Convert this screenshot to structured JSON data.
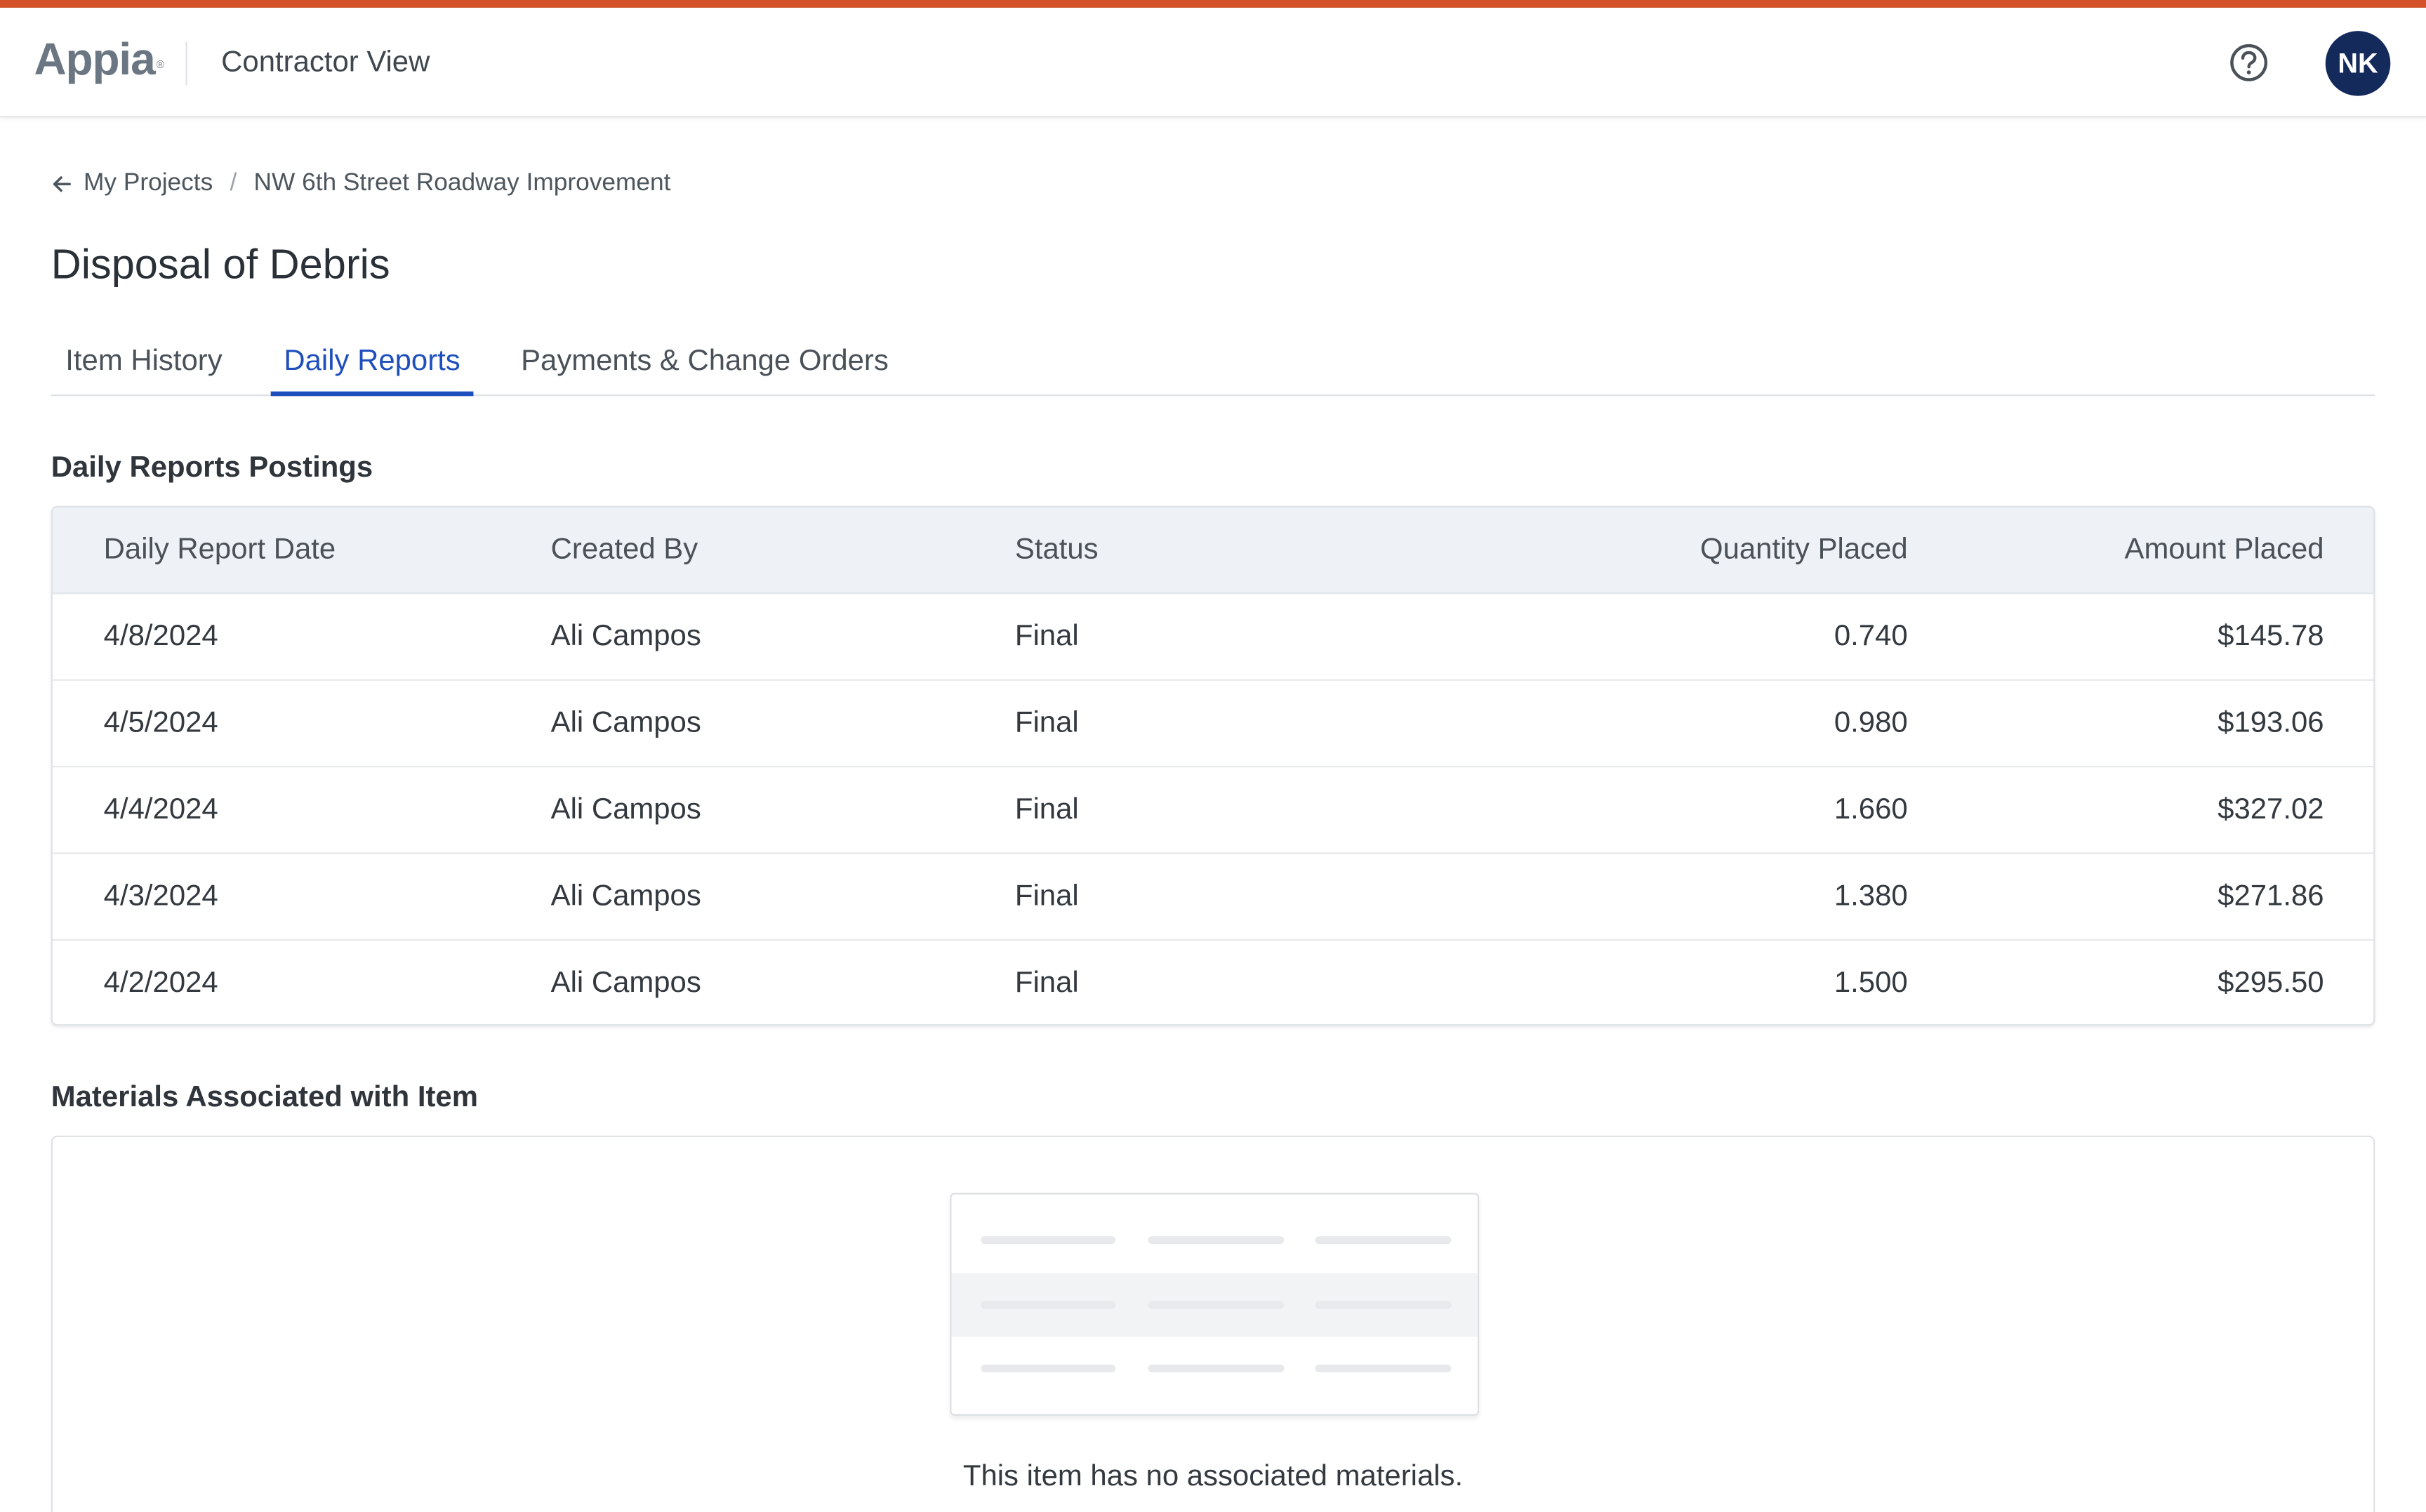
{
  "header": {
    "logo": "Appia",
    "logo_mark": "®",
    "app_title": "Contractor View",
    "help_icon": "question-circle-icon",
    "avatar_initials": "NK",
    "accent_bar_color": "#d4522a",
    "avatar_color": "#142a5b"
  },
  "breadcrumb": {
    "back_icon": "arrow-left-icon",
    "parent": "My Projects",
    "separator": "/",
    "current": "NW 6th Street Roadway Improvement"
  },
  "page": {
    "title": "Disposal of Debris"
  },
  "tabs": [
    {
      "label": "Item History",
      "active": false
    },
    {
      "label": "Daily Reports",
      "active": true
    },
    {
      "label": "Payments & Change Orders",
      "active": false
    }
  ],
  "tab_active_color": "#1f4fbd",
  "daily_reports": {
    "title": "Daily Reports Postings",
    "columns": [
      "Daily Report Date",
      "Created By",
      "Status",
      "Quantity Placed",
      "Amount Placed"
    ],
    "rows": [
      {
        "date": "4/8/2024",
        "created_by": "Ali Campos",
        "status": "Final",
        "quantity": "0.740",
        "amount": "$145.78"
      },
      {
        "date": "4/5/2024",
        "created_by": "Ali Campos",
        "status": "Final",
        "quantity": "0.980",
        "amount": "$193.06"
      },
      {
        "date": "4/4/2024",
        "created_by": "Ali Campos",
        "status": "Final",
        "quantity": "1.660",
        "amount": "$327.02"
      },
      {
        "date": "4/3/2024",
        "created_by": "Ali Campos",
        "status": "Final",
        "quantity": "1.380",
        "amount": "$271.86"
      },
      {
        "date": "4/2/2024",
        "created_by": "Ali Campos",
        "status": "Final",
        "quantity": "1.500",
        "amount": "$295.50"
      }
    ]
  },
  "materials": {
    "title": "Materials Associated with Item",
    "empty_icon": "empty-table-illustration",
    "empty_message": "This item has no associated materials."
  }
}
